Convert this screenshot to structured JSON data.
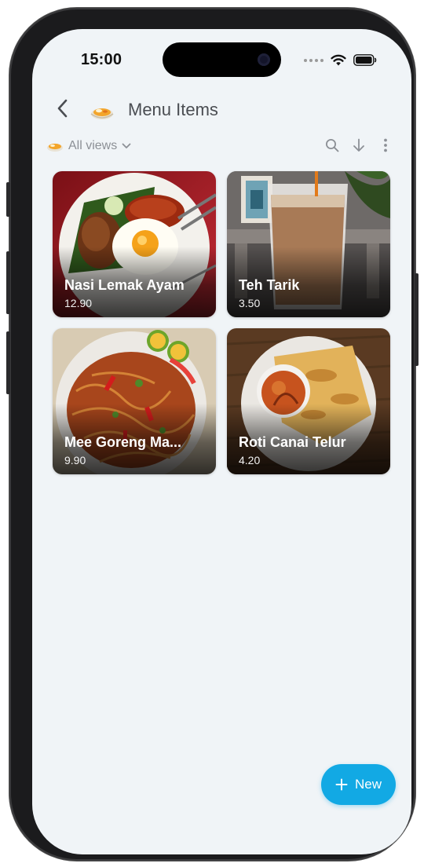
{
  "status_bar": {
    "time": "15:00"
  },
  "header": {
    "title": "Menu Items",
    "back_icon": "back-chevron-icon",
    "app_icon": "curry-bowl-icon"
  },
  "viewbar": {
    "views_label": "All views",
    "icons": [
      "search-icon",
      "sort-down-arrow-icon",
      "more-vertical-icon"
    ]
  },
  "items": [
    {
      "name": "Nasi Lemak Ayam",
      "price": "12.90",
      "photo": "nasi-lemak-photo"
    },
    {
      "name": "Teh Tarik",
      "price": "3.50",
      "photo": "teh-tarik-photo"
    },
    {
      "name": "Mee Goreng Ma...",
      "price": "9.90",
      "photo": "mee-goreng-photo"
    },
    {
      "name": "Roti Canai Telur",
      "price": "4.20",
      "photo": "roti-canai-photo"
    }
  ],
  "fab": {
    "label": "New"
  },
  "colors": {
    "accent": "#12a9e4",
    "background": "#f0f4f7",
    "title": "#4a4d52",
    "muted": "#8c9096"
  }
}
